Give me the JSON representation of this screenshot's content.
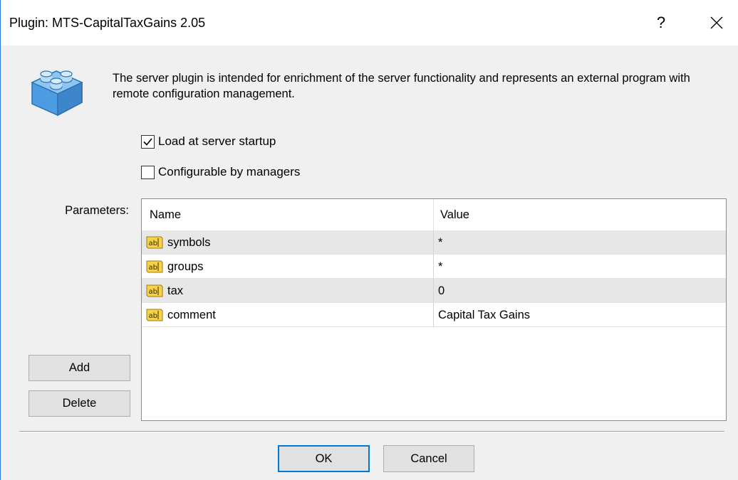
{
  "window": {
    "title": "Plugin: MTS-CapitalTaxGains 2.05",
    "help_label": "?",
    "close_icon": "close-icon"
  },
  "description": "The server plugin is intended for enrichment of the server functionality and represents an external program with remote configuration management.",
  "options": {
    "load_at_startup": {
      "label": "Load at server startup",
      "checked": true
    },
    "configurable_by_managers": {
      "label": "Configurable by managers",
      "checked": false
    }
  },
  "parameters": {
    "label": "Parameters:",
    "columns": {
      "name": "Name",
      "value": "Value"
    },
    "rows": [
      {
        "name": "symbols",
        "value": "*"
      },
      {
        "name": "groups",
        "value": "*"
      },
      {
        "name": "tax",
        "value": "0"
      },
      {
        "name": "comment",
        "value": "Capital Tax Gains"
      }
    ],
    "row_icon": "ab-text-icon"
  },
  "buttons": {
    "add": "Add",
    "delete": "Delete",
    "ok": "OK",
    "cancel": "Cancel"
  },
  "colors": {
    "accent": "#0078d7",
    "dialog_bg": "#f0f0f0",
    "row_alt_bg": "#e7e7e7",
    "plugin_icon": "#5aa8e6"
  }
}
